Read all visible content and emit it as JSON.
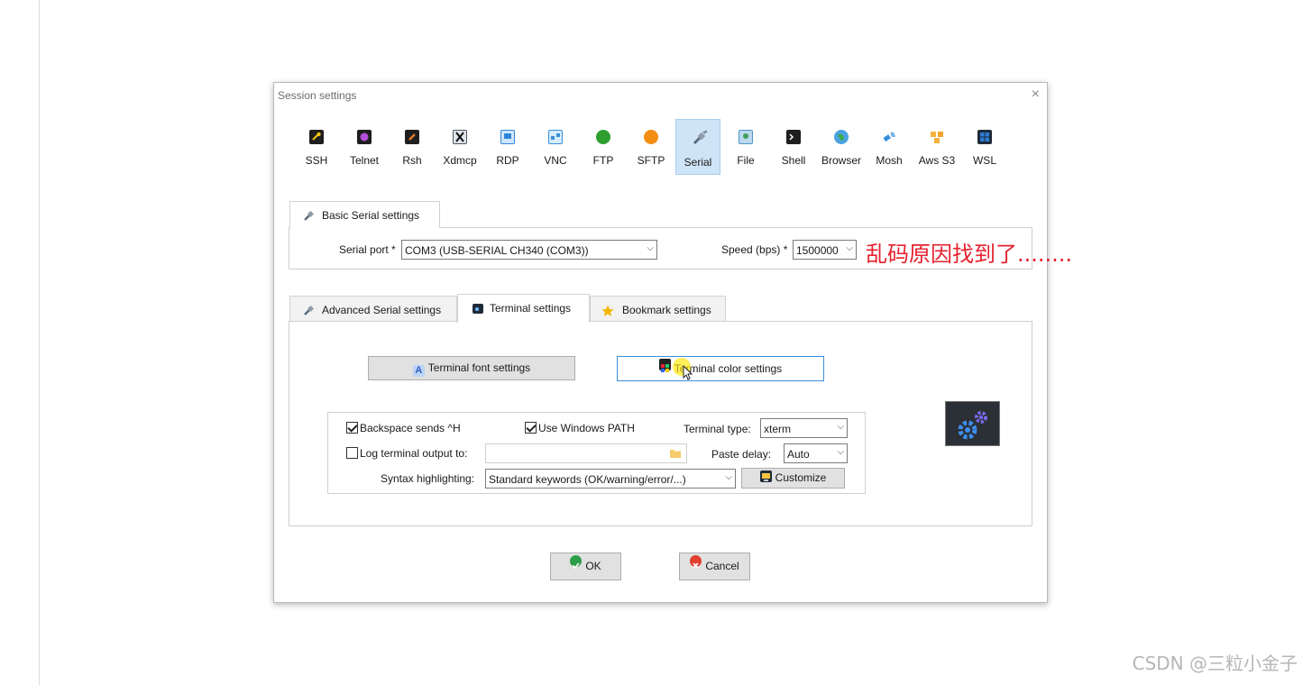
{
  "dialog": {
    "title": "Session settings",
    "close_glyph": "×"
  },
  "session_types": [
    {
      "label": "SSH",
      "icon": "key-icon",
      "color": "#f2c314",
      "bg": "#1e1e1e"
    },
    {
      "label": "Telnet",
      "icon": "telnet-icon",
      "color": "#b24fd6",
      "bg": "#1e1e1e"
    },
    {
      "label": "Rsh",
      "icon": "rsh-icon",
      "color": "#e27a2b",
      "bg": "#1e1e1e"
    },
    {
      "label": "Xdmcp",
      "icon": "x-icon",
      "color": "#111111",
      "bg": "#dfe6ee"
    },
    {
      "label": "RDP",
      "icon": "monitor-windows-icon",
      "color": "#2f86d8",
      "bg": "#cfe6fa"
    },
    {
      "label": "VNC",
      "icon": "vnc-icon",
      "color": "#3a8fd9",
      "bg": "#d6ecfb"
    },
    {
      "label": "FTP",
      "icon": "globe-green-icon",
      "color": "#3bab3b",
      "bg": "#2e9e2e"
    },
    {
      "label": "SFTP",
      "icon": "globe-orange-icon",
      "color": "#f09a1a",
      "bg": "#f28f13"
    },
    {
      "label": "Serial",
      "icon": "serial-plug-icon",
      "color": "#5a6a7d",
      "bg": "#8f9caa"
    },
    {
      "label": "File",
      "icon": "file-monitor-icon",
      "color": "#4f97c8",
      "bg": "#bcd9ee"
    },
    {
      "label": "Shell",
      "icon": "shell-prompt-icon",
      "color": "#ffffff",
      "bg": "#1e1e1e"
    },
    {
      "label": "Browser",
      "icon": "browser-globe-icon",
      "color": "#2e8bd4",
      "bg": "#4ba3e0"
    },
    {
      "label": "Mosh",
      "icon": "satellite-icon",
      "color": "#2e7fd1",
      "bg": "#3a8fdc"
    },
    {
      "label": "Aws S3",
      "icon": "aws-cubes-icon",
      "color": "#f4a52a",
      "bg": "#f6b23e"
    },
    {
      "label": "WSL",
      "icon": "windows-logo-icon",
      "color": "#2a7bd5",
      "bg": "#1f2a3a"
    }
  ],
  "active_session_type": "Serial",
  "basic_tab": {
    "label": "Basic Serial settings"
  },
  "serial_port": {
    "label": "Serial port *",
    "value": "COM3  (USB-SERIAL CH340 (COM3))"
  },
  "speed": {
    "label": "Speed (bps) *",
    "value": "1500000"
  },
  "dropdown_arrow": "⌵",
  "annotation": "乱码原因找到了........",
  "lower_tabs": [
    {
      "label": "Advanced Serial settings",
      "icon": "serial-plug-icon"
    },
    {
      "label": "Terminal settings",
      "icon": "terminal-icon"
    },
    {
      "label": "Bookmark settings",
      "icon": "star-icon"
    }
  ],
  "selected_lower_tab": "Terminal settings",
  "terminal_font_button": {
    "label": "Terminal font settings",
    "icon": "font-a-icon"
  },
  "terminal_color_button": {
    "label": "Terminal color settings",
    "icon": "palette-icon"
  },
  "options": {
    "backspace": {
      "label": "Backspace sends ^H",
      "checked": true
    },
    "windows_path": {
      "label": "Use Windows PATH",
      "checked": true
    },
    "terminal_type": {
      "label": "Terminal type:",
      "value": "xterm"
    },
    "log_output": {
      "label": "Log terminal output to:",
      "checked": false,
      "value": ""
    },
    "paste_delay": {
      "label": "Paste delay:",
      "value": "Auto"
    },
    "syntax": {
      "label": "Syntax highlighting:",
      "value": "Standard keywords (OK/warning/error/...)"
    },
    "customize_button": {
      "label": "Customize"
    }
  },
  "ok_button": {
    "label": "OK",
    "icon": "check-circle-icon",
    "color": "#2c9d48"
  },
  "cancel_button": {
    "label": "Cancel",
    "icon": "cancel-circle-icon",
    "color": "#e1402f"
  },
  "watermark": "CSDN @三粒小金子"
}
